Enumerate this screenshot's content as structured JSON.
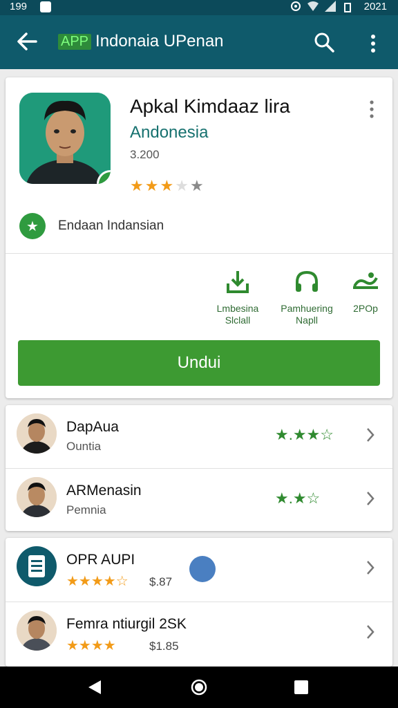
{
  "status_bar": {
    "time": "199",
    "right_time": "2021",
    "icons": [
      "notification-icon",
      "sync-icon",
      "wifi-icon",
      "signal-icon",
      "battery-icon"
    ]
  },
  "app_bar": {
    "app_badge": "APP",
    "title": "Indonaia UPenan",
    "icons": [
      "back-arrow-icon",
      "search-icon",
      "more-vert-icon"
    ]
  },
  "app_card": {
    "title": "Apkal Kimdaaz lira",
    "developer": "Andonesia",
    "downloads": "3.200",
    "rating_stars": 3,
    "max_stars": 5,
    "category_label": "Endaan Indansian",
    "features": [
      {
        "line1": "Lmbesina",
        "line2": "Slclall",
        "icon": "download-tray-icon"
      },
      {
        "line1": "Pamhuering",
        "line2": "Napll",
        "icon": "headset-icon"
      },
      {
        "line1": "2POp",
        "line2": "",
        "icon": "sync-link-icon"
      }
    ],
    "install_label": "Undui"
  },
  "list_card_1": [
    {
      "title": "DapAua",
      "subtitle": "Ountia",
      "icon": "avatar",
      "stars": "★.★★☆"
    },
    {
      "title": "ARMenasin",
      "subtitle": "Pemnia",
      "icon": "avatar",
      "stars": "★.★☆"
    }
  ],
  "list_card_2": [
    {
      "title": "OPR AUPI",
      "price": "$.87",
      "icon": "document-icon",
      "stars": "★★★★☆"
    },
    {
      "title": "Femra ntiurgil 2SK",
      "price": "$1.85",
      "icon": "avatar",
      "stars": "★★★★"
    }
  ],
  "colors": {
    "status_bar": "#0c4a5a",
    "app_bar": "#0f5a6b",
    "install_button": "#3d9a32",
    "developer_text": "#16716f",
    "star": "#f29b18",
    "feature_green": "#2f6b33"
  }
}
